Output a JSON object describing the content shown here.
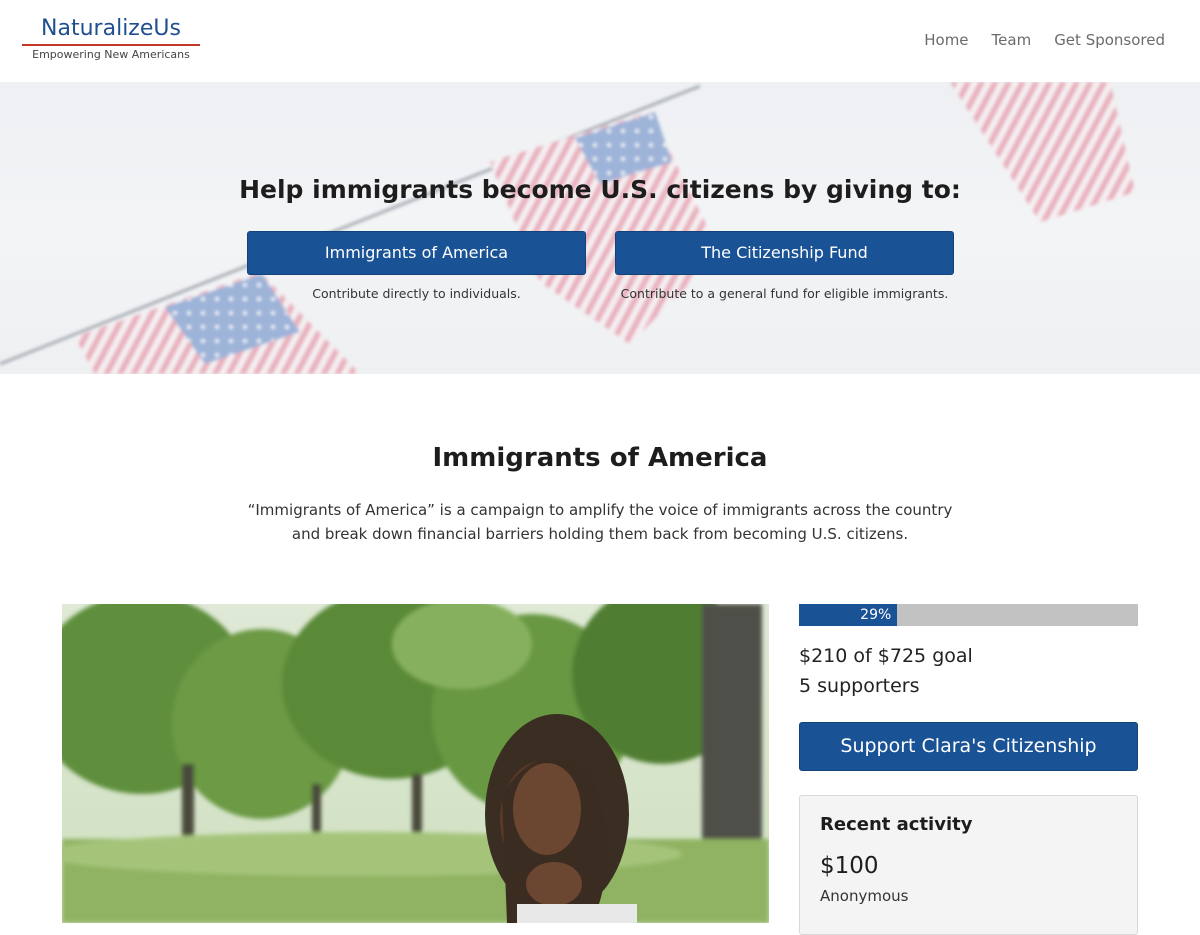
{
  "brand": {
    "name": "NaturalizeUs",
    "tagline": "Empowering New Americans"
  },
  "nav": {
    "items": [
      {
        "label": "Home"
      },
      {
        "label": "Team"
      },
      {
        "label": "Get Sponsored"
      }
    ]
  },
  "hero": {
    "title": "Help immigrants become U.S. citizens by giving to:",
    "options": [
      {
        "button": "Immigrants of America",
        "caption": "Contribute directly to individuals."
      },
      {
        "button": "The Citizenship Fund",
        "caption": "Contribute to a general fund for eligible immigrants."
      }
    ]
  },
  "campaign": {
    "title": "Immigrants of America",
    "description_line1": "“Immigrants of America” is a campaign to amplify the voice of immigrants across the country",
    "description_line2": "and break down financial barriers holding them back from becoming U.S. citizens."
  },
  "fundraiser": {
    "progress_percent": 29,
    "progress_label": "29%",
    "raised": "$210",
    "of_text": "of",
    "goal": "$725",
    "goal_text": "goal",
    "supporters_count": "5",
    "supporters_text": "supporters",
    "support_button": "Support Clara's Citizenship"
  },
  "activity": {
    "title": "Recent activity",
    "items": [
      {
        "amount": "$100",
        "name": "Anonymous"
      }
    ]
  },
  "colors": {
    "primary": "#1a5296",
    "accent_red": "#c0392b",
    "progress_track": "#c2c2c2"
  },
  "icons": {
    "hero_background": "american-flag-bunting",
    "campaign_photo": "woman-in-park"
  }
}
